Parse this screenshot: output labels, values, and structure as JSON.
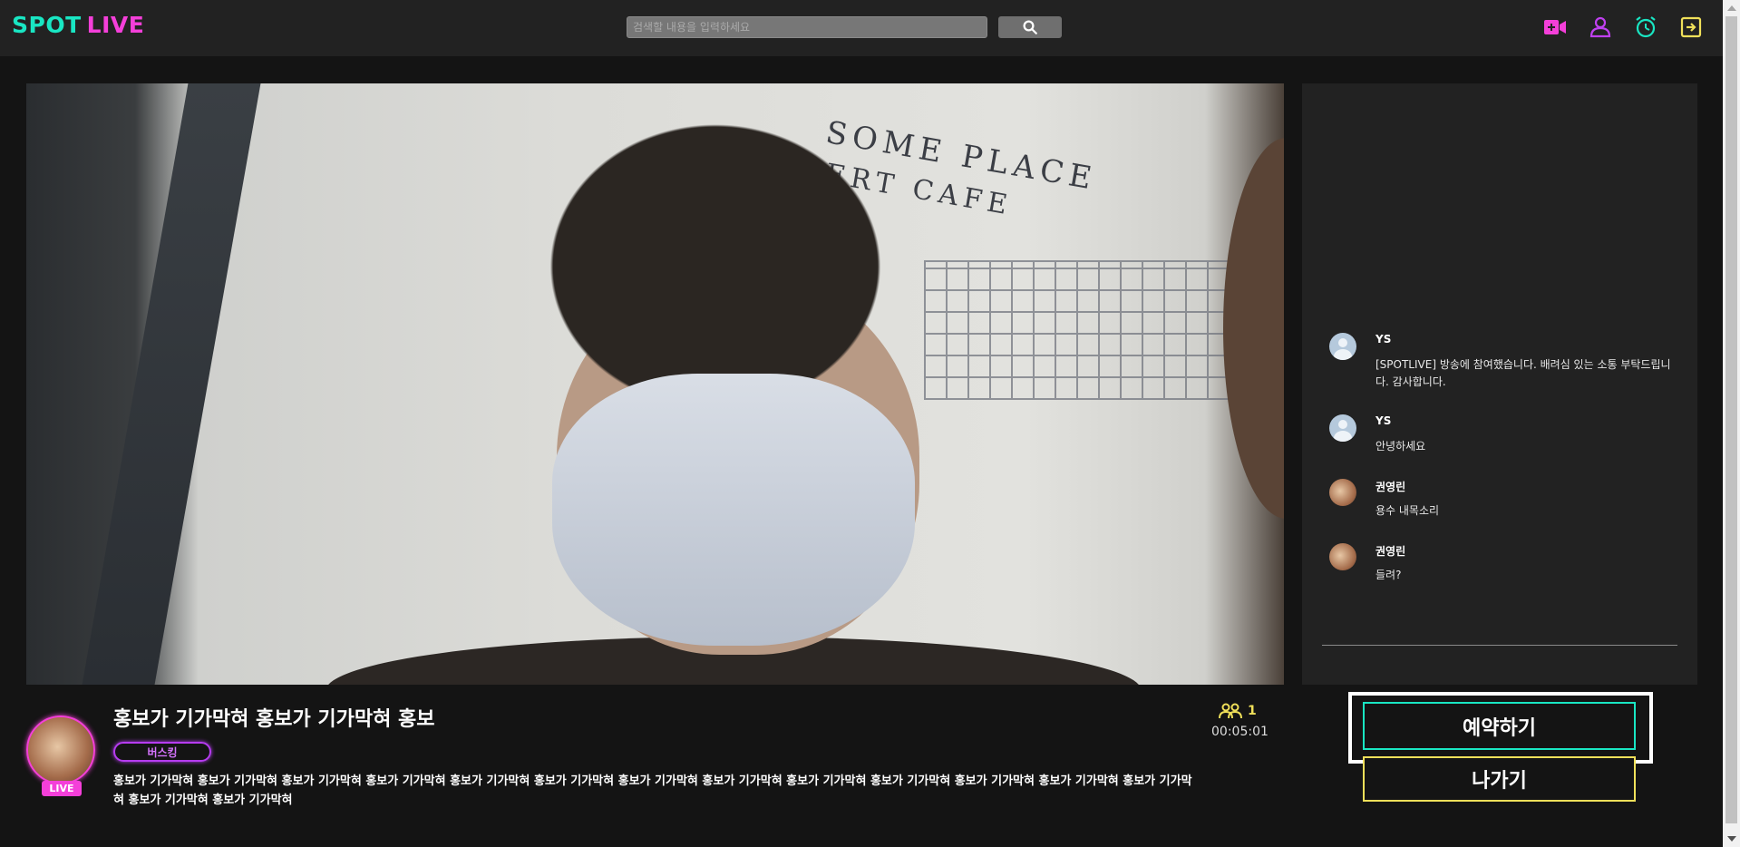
{
  "header": {
    "logo_part1": "SPOT",
    "logo_part2": "LIVE",
    "search_placeholder": "검색할 내용을 입력하세요",
    "search_icon": "magnifier-icon",
    "icons": [
      "video-add-icon",
      "user-icon",
      "alarm-clock-icon",
      "logout-icon"
    ]
  },
  "colors": {
    "accent_teal": "#19e6c3",
    "accent_pink": "#f43fd9",
    "accent_purple": "#b63cf0",
    "accent_yellow": "#f0e05a"
  },
  "video": {
    "wall_text_line1": "SOME PLACE",
    "wall_text_line2": "ERT CAFE"
  },
  "chat": {
    "messages": [
      {
        "user": "YS",
        "text": "[SPOTLIVE] 방송에 참여했습니다. 배려심 있는 소통 부탁드립니다. 감사합니다.",
        "avatar": "default-avatar-icon"
      },
      {
        "user": "YS",
        "text": "안녕하세요",
        "avatar": "default-avatar-icon"
      },
      {
        "user": "권영린",
        "text": "용수 내목소리",
        "avatar": "photo-avatar"
      },
      {
        "user": "권영린",
        "text": "들려?",
        "avatar": "photo-avatar"
      }
    ]
  },
  "stream": {
    "live_badge": "LIVE",
    "title": "홍보가 기가막혀 홍보가 기가막혀 홍보",
    "category": "버스킹",
    "description": "홍보가 기가막혀 홍보가 기가막혀 홍보가 기가막혀 홍보가 기가막혀 홍보가 기가막혀 홍보가 기가막혀 홍보가 기가막혀 홍보가 기가막혀 홍보가 기가막혀 홍보가 기가막혀 홍보가 기가막혀 홍보가 기가막혀 홍보가 기가막혀 홍보가 기가막혀 홍보가 기가막혀",
    "viewer_count": "1",
    "viewer_icon": "people-icon",
    "elapsed_time": "00:05:01"
  },
  "actions": {
    "reserve_label": "예약하기",
    "exit_label": "나가기"
  }
}
